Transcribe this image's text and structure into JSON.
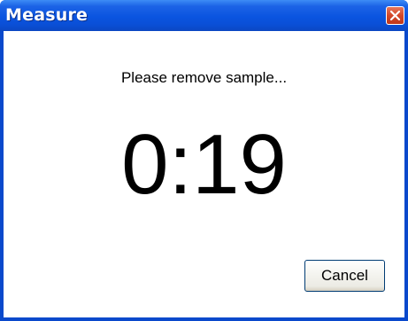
{
  "window": {
    "title": "Measure"
  },
  "titlebar_icons": {
    "close": "close-icon"
  },
  "dialog": {
    "prompt": "Please remove sample...",
    "timer": "0:19",
    "cancel_label": "Cancel"
  },
  "colors": {
    "titlebar": "#0a54e0",
    "close_button": "#d3482a",
    "client_background": "#ffffff"
  }
}
